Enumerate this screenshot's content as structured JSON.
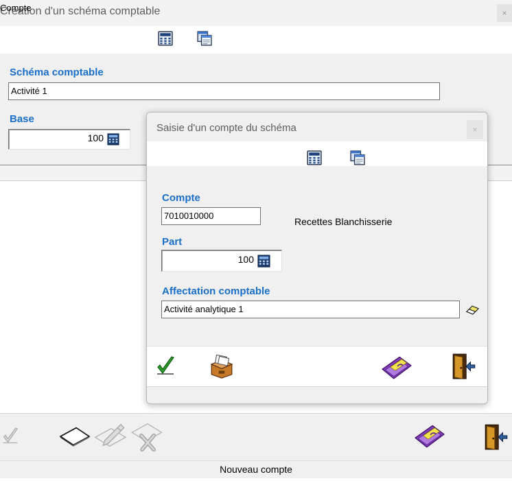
{
  "main": {
    "title": "Création d'un schéma comptable",
    "close_label": "×",
    "schema_label": "Schéma comptable",
    "schema_value": "Activité 1",
    "base_label": "Base",
    "base_value": "100",
    "column_header": "Compte"
  },
  "dialog": {
    "title": "Saisie d'un compte du schéma",
    "close_label": "×",
    "compte_label": "Compte",
    "compte_value": "7010010000",
    "compte_description": "Recettes Blanchisserie",
    "part_label": "Part",
    "part_value": "100",
    "affectation_label": "Affectation comptable",
    "affectation_value": "Activité analytique 1"
  },
  "status": {
    "text": "Nouveau compte"
  },
  "icons": {
    "toolbar": [
      "calculator-icon",
      "window-copy-icon"
    ],
    "dialog_actions": [
      "validate-check-icon",
      "card-box-icon",
      "wallet-cards-icon",
      "exit-door-icon"
    ],
    "bottom_actions": [
      "validate-check-disabled-icon",
      "new-sheet-icon",
      "edit-disabled-icon",
      "delete-disabled-icon",
      "wallet-cards-icon",
      "exit-door-icon"
    ],
    "field_tools": [
      "calculator-small-icon",
      "eraser-icon"
    ]
  },
  "colors": {
    "accent_label": "#1a6fc9",
    "check_green": "#2e9e2e",
    "wallet_purple": "#8a3fc3"
  }
}
